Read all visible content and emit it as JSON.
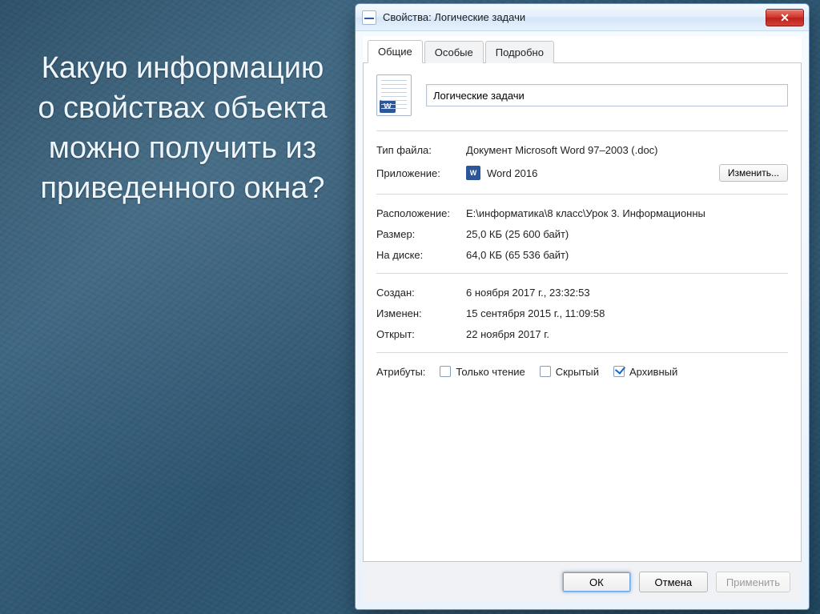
{
  "slide": {
    "question": "Какую информацию о свойствах объекта можно получить из приведенного окна?"
  },
  "window": {
    "title": "Свойства: Логические задачи"
  },
  "tabs": [
    "Общие",
    "Особые",
    "Подробно"
  ],
  "labels": {
    "file_type": "Тип файла:",
    "opens_with": "Приложение:",
    "location": "Расположение:",
    "size": "Размер:",
    "size_on_disk": "На диске:",
    "created": "Создан:",
    "modified": "Изменен:",
    "accessed": "Открыт:",
    "attributes": "Атрибуты:"
  },
  "file": {
    "name": "Логические задачи",
    "type": "Документ Microsoft Word 97–2003 (.doc)",
    "app": "Word 2016",
    "location": "E:\\информатика\\8 класс\\Урок 3. Информационны",
    "size": "25,0 КБ (25 600 байт)",
    "size_on_disk": "64,0 КБ (65 536 байт)",
    "created": "6 ноября 2017 г., 23:32:53",
    "modified": "15 сентября 2015 г., 11:09:58",
    "accessed": "22 ноября 2017 г."
  },
  "attributes": [
    {
      "label": "Только чтение",
      "checked": false
    },
    {
      "label": "Скрытый",
      "checked": false
    },
    {
      "label": "Архивный",
      "checked": true
    }
  ],
  "buttons": {
    "change": "Изменить...",
    "ok": "ОК",
    "cancel": "Отмена",
    "apply": "Применить"
  }
}
